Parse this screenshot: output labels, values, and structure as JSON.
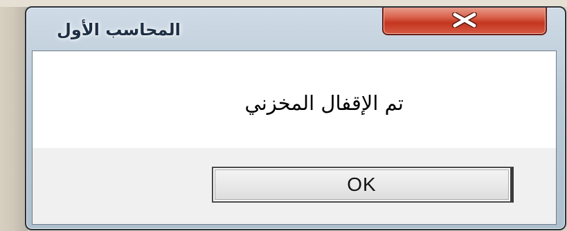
{
  "window": {
    "title": "المحاسب الأول",
    "close_icon": "close-x-icon"
  },
  "dialog": {
    "message": "تم الإقفال المخزني",
    "ok_label": "OK"
  },
  "colors": {
    "close_button": "#c4351f",
    "frame": "#c5d3df",
    "client_background": "#f0f0f0",
    "message_background": "#ffffff"
  }
}
